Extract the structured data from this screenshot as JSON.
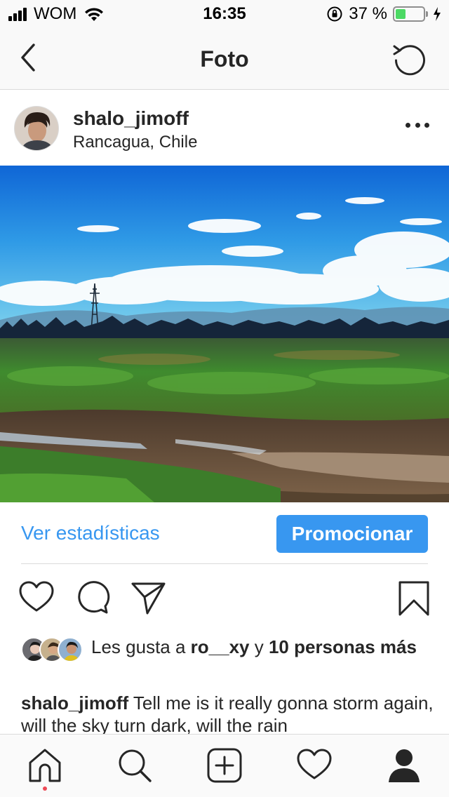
{
  "status_bar": {
    "carrier": "WOM",
    "time": "16:35",
    "battery_pct": "37 %",
    "battery_level": 0.37
  },
  "nav": {
    "title": "Foto",
    "back_icon": "chevron-left-icon",
    "refresh_icon": "refresh-icon"
  },
  "post": {
    "username": "shalo_jimoff",
    "location": "Rancagua, Chile",
    "stats_link": "Ver estadísticas",
    "promote_label": "Promocionar",
    "likes": {
      "prefix": "Les gusta a ",
      "first_user": "ro__xy",
      "connector": " y ",
      "others": "10 personas más"
    },
    "caption": {
      "author": "shalo_jimoff",
      "text": " Tell me is it really gonna storm again, will the sky turn dark, will the rain"
    }
  },
  "colors": {
    "accent": "#3897f0",
    "text": "#262626",
    "divider": "#dbdbdb",
    "notification_dot": "#ed4956",
    "battery": "#4cd964"
  },
  "tab_bar": {
    "items": [
      "home-icon",
      "search-icon",
      "add-icon",
      "heart-icon",
      "profile-icon"
    ]
  }
}
